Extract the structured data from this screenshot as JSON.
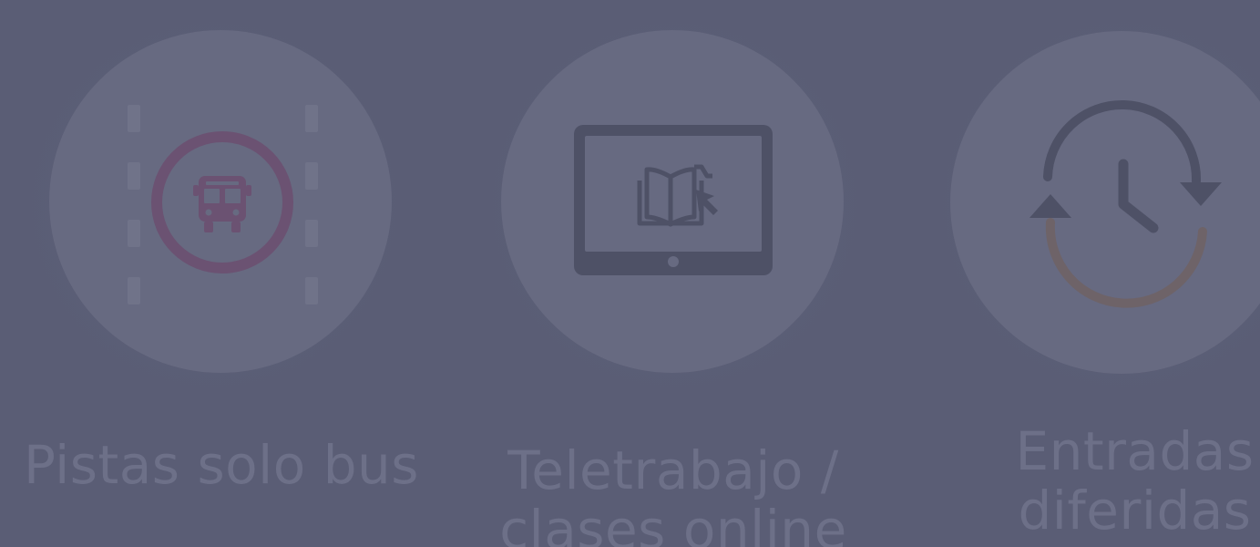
{
  "items": [
    {
      "label_lines": [
        "Pistas solo bus"
      ],
      "icon": "bus-lane-icon"
    },
    {
      "label_lines": [
        "Teletrabajo /",
        "clases online"
      ],
      "icon": "tablet-book-icon"
    },
    {
      "label_lines": [
        "Entradas",
        "diferidas"
      ],
      "icon": "clock-cycle-icon"
    }
  ],
  "colors": {
    "background": "#5a5d75",
    "circle": "#676a81",
    "text": "#6d7088",
    "icon_dark": "#4e5166",
    "bus_accent": "#6b5272",
    "lane_marks": "#707389",
    "arrow_warm": "#6e6368"
  }
}
